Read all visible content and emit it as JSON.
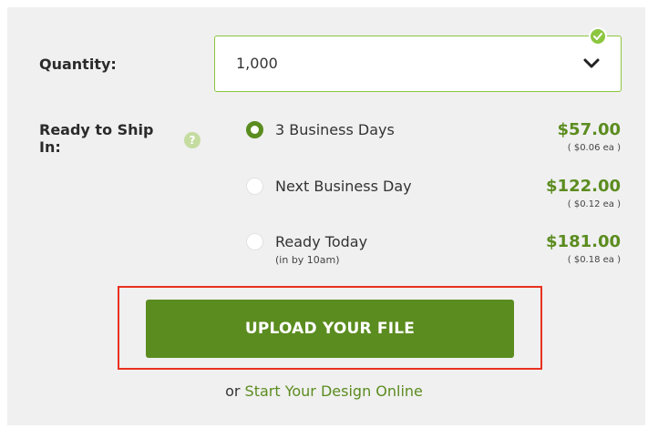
{
  "quantity": {
    "label": "Quantity:",
    "value": "1,000",
    "icons": {
      "dropdown": "chevron-down-icon",
      "valid": "check-circle-icon"
    }
  },
  "shipping": {
    "label": "Ready to Ship In:",
    "help_icon_glyph": "?",
    "options": [
      {
        "label": "3 Business Days",
        "sublabel": "",
        "price": "$57.00",
        "each": "( $0.06 ea )",
        "selected": true
      },
      {
        "label": "Next Business Day",
        "sublabel": "",
        "price": "$122.00",
        "each": "( $0.12 ea )",
        "selected": false
      },
      {
        "label": "Ready Today",
        "sublabel": "(in by 10am)",
        "price": "$181.00",
        "each": "( $0.18 ea )",
        "selected": false
      }
    ]
  },
  "upload": {
    "label": "UPLOAD YOUR FILE"
  },
  "design": {
    "prefix": "or",
    "link_label": "Start Your Design Online"
  },
  "colors": {
    "accent": "#5b8c1f",
    "border_valid": "#8cc63f",
    "highlight": "#e8311f",
    "panel": "#f0f0f0"
  }
}
